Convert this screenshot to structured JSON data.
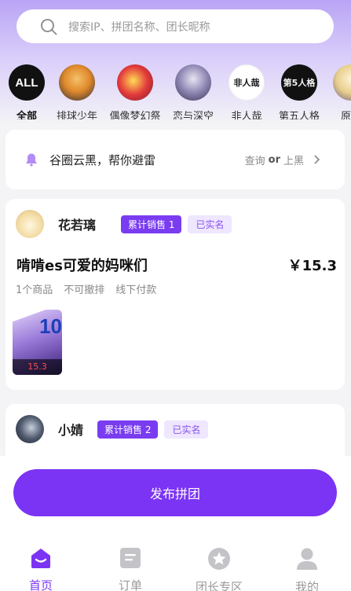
{
  "search": {
    "placeholder": "搜索IP、拼团名称、团长昵称"
  },
  "categories": [
    {
      "label": "全部",
      "logo_text": "ALL"
    },
    {
      "label": "排球少年"
    },
    {
      "label": "偶像梦幻祭"
    },
    {
      "label": "恋与深空"
    },
    {
      "label": "非人哉",
      "logo_text": "非人哉"
    },
    {
      "label": "第五人格",
      "logo_text": "第5人格"
    },
    {
      "label": "原"
    }
  ],
  "notice": {
    "text": "谷圈云黑，帮你避雷",
    "query": "查询",
    "or": "or",
    "report": "上黑"
  },
  "groups": [
    {
      "leader": "花若璃",
      "sales_badge": "累计销售 1",
      "verified": "已实名",
      "title": "啃啃es可爱的妈咪们",
      "price": "￥15.3",
      "meta": [
        "1个商品",
        "不可撤排",
        "线下付款"
      ],
      "thumb_price": "15.3",
      "thumb_overlay": "10"
    },
    {
      "leader": "小婧",
      "sales_badge": "累计销售 2",
      "verified": "已实名"
    }
  ],
  "publish_label": "发布拼团",
  "tabs": [
    {
      "label": "首页"
    },
    {
      "label": "订单"
    },
    {
      "label": "团长专区"
    },
    {
      "label": "我的"
    }
  ],
  "colors": {
    "accent": "#7b34f4",
    "badge_bg": "#7a3cf1",
    "verified_bg": "#efe6ff"
  }
}
